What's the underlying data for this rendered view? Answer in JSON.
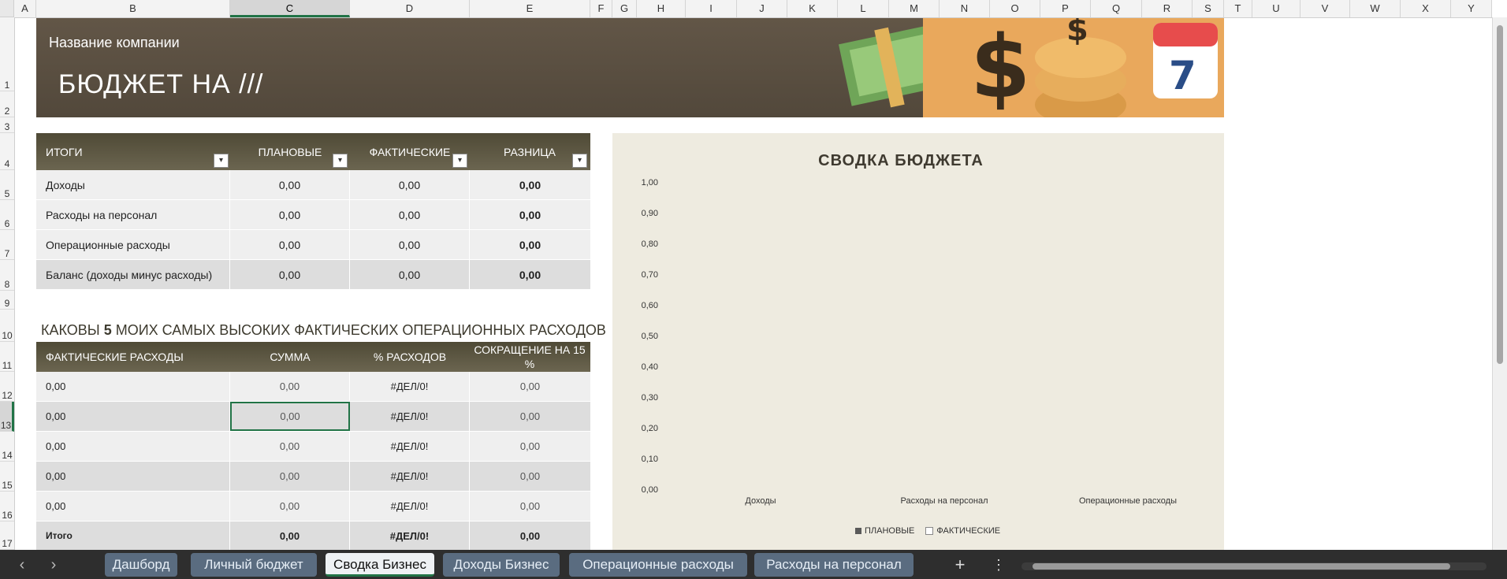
{
  "columns": [
    "A",
    "B",
    "C",
    "D",
    "E",
    "F",
    "G",
    "H",
    "I",
    "J",
    "K",
    "L",
    "M",
    "N",
    "O",
    "P",
    "Q",
    "R",
    "S",
    "T",
    "U",
    "V",
    "W",
    "X",
    "Y"
  ],
  "rows": [
    "1",
    "2",
    "3",
    "4",
    "5",
    "6",
    "7",
    "8",
    "9",
    "10",
    "11",
    "12",
    "13",
    "14",
    "15",
    "16",
    "17"
  ],
  "banner": {
    "company": "Название компании",
    "title": "БЮДЖЕТ НА ///"
  },
  "totals": {
    "headers": [
      "ИТОГИ",
      "ПЛАНОВЫЕ",
      "ФАКТИЧЕСКИЕ",
      "РАЗНИЦА"
    ],
    "rows": [
      {
        "label": "Доходы",
        "planned": "0,00",
        "actual": "0,00",
        "diff": "0,00"
      },
      {
        "label": "Расходы на персонал",
        "planned": "0,00",
        "actual": "0,00",
        "diff": "0,00"
      },
      {
        "label": "Операционные расходы",
        "planned": "0,00",
        "actual": "0,00",
        "diff": "0,00"
      },
      {
        "label": "Баланс (доходы минус расходы)",
        "planned": "0,00",
        "actual": "0,00",
        "diff": "0,00"
      }
    ]
  },
  "top5": {
    "title_pre": "КАКОВЫ ",
    "title_num": "5",
    "title_post": " МОИХ САМЫХ ВЫСОКИХ ФАКТИЧЕСКИХ ОПЕРАЦИОННЫХ РАСХОДОВ",
    "headers": [
      "ФАКТИЧЕСКИЕ РАСХОДЫ",
      "СУММА",
      "% РАСХОДОВ",
      "СОКРАЩЕНИЕ НА 15 %"
    ],
    "rows": [
      {
        "label": "0,00",
        "sum": "0,00",
        "pct": "#ДЕЛ/0!",
        "cut": "0,00"
      },
      {
        "label": "0,00",
        "sum": "0,00",
        "pct": "#ДЕЛ/0!",
        "cut": "0,00"
      },
      {
        "label": "0,00",
        "sum": "0,00",
        "pct": "#ДЕЛ/0!",
        "cut": "0,00"
      },
      {
        "label": "0,00",
        "sum": "0,00",
        "pct": "#ДЕЛ/0!",
        "cut": "0,00"
      },
      {
        "label": "0,00",
        "sum": "0,00",
        "pct": "#ДЕЛ/0!",
        "cut": "0,00"
      }
    ],
    "total": {
      "label": "Итого",
      "sum": "0,00",
      "pct": "#ДЕЛ/0!",
      "cut": "0,00"
    }
  },
  "chart_data": {
    "type": "bar",
    "title": "СВОДКА БЮДЖЕТА",
    "categories": [
      "Доходы",
      "Расходы на персонал",
      "Операционные расходы"
    ],
    "series": [
      {
        "name": "ПЛАНОВЫЕ",
        "values": [
          0,
          0,
          0
        ],
        "color": "#5a5a5a"
      },
      {
        "name": "ФАКТИЧЕСКИЕ",
        "values": [
          0,
          0,
          0
        ],
        "color": "#ffffff"
      }
    ],
    "ylim": [
      0,
      1
    ],
    "yticks": [
      "1,00",
      "0,90",
      "0,80",
      "0,70",
      "0,60",
      "0,50",
      "0,40",
      "0,30",
      "0,20",
      "0,10",
      "0,00"
    ],
    "legend": "bottom"
  },
  "sheet_tabs": [
    "Дашборд",
    "Личный бюджет",
    "Сводка Бизнес",
    "Доходы Бизнес",
    "Операционные расходы",
    "Расходы на персонал"
  ],
  "active_tab": "Сводка Бизнес",
  "icons": {
    "prev": "chevron-left-icon",
    "next": "chevron-right-icon",
    "add": "plus-icon",
    "more": "more-vertical-icon"
  },
  "colors": {
    "banner": "#5a4f41",
    "header_band": "#5b5542",
    "chart_bg": "#eeebe0",
    "tab": "#5a6c80",
    "accent": "#217346"
  }
}
